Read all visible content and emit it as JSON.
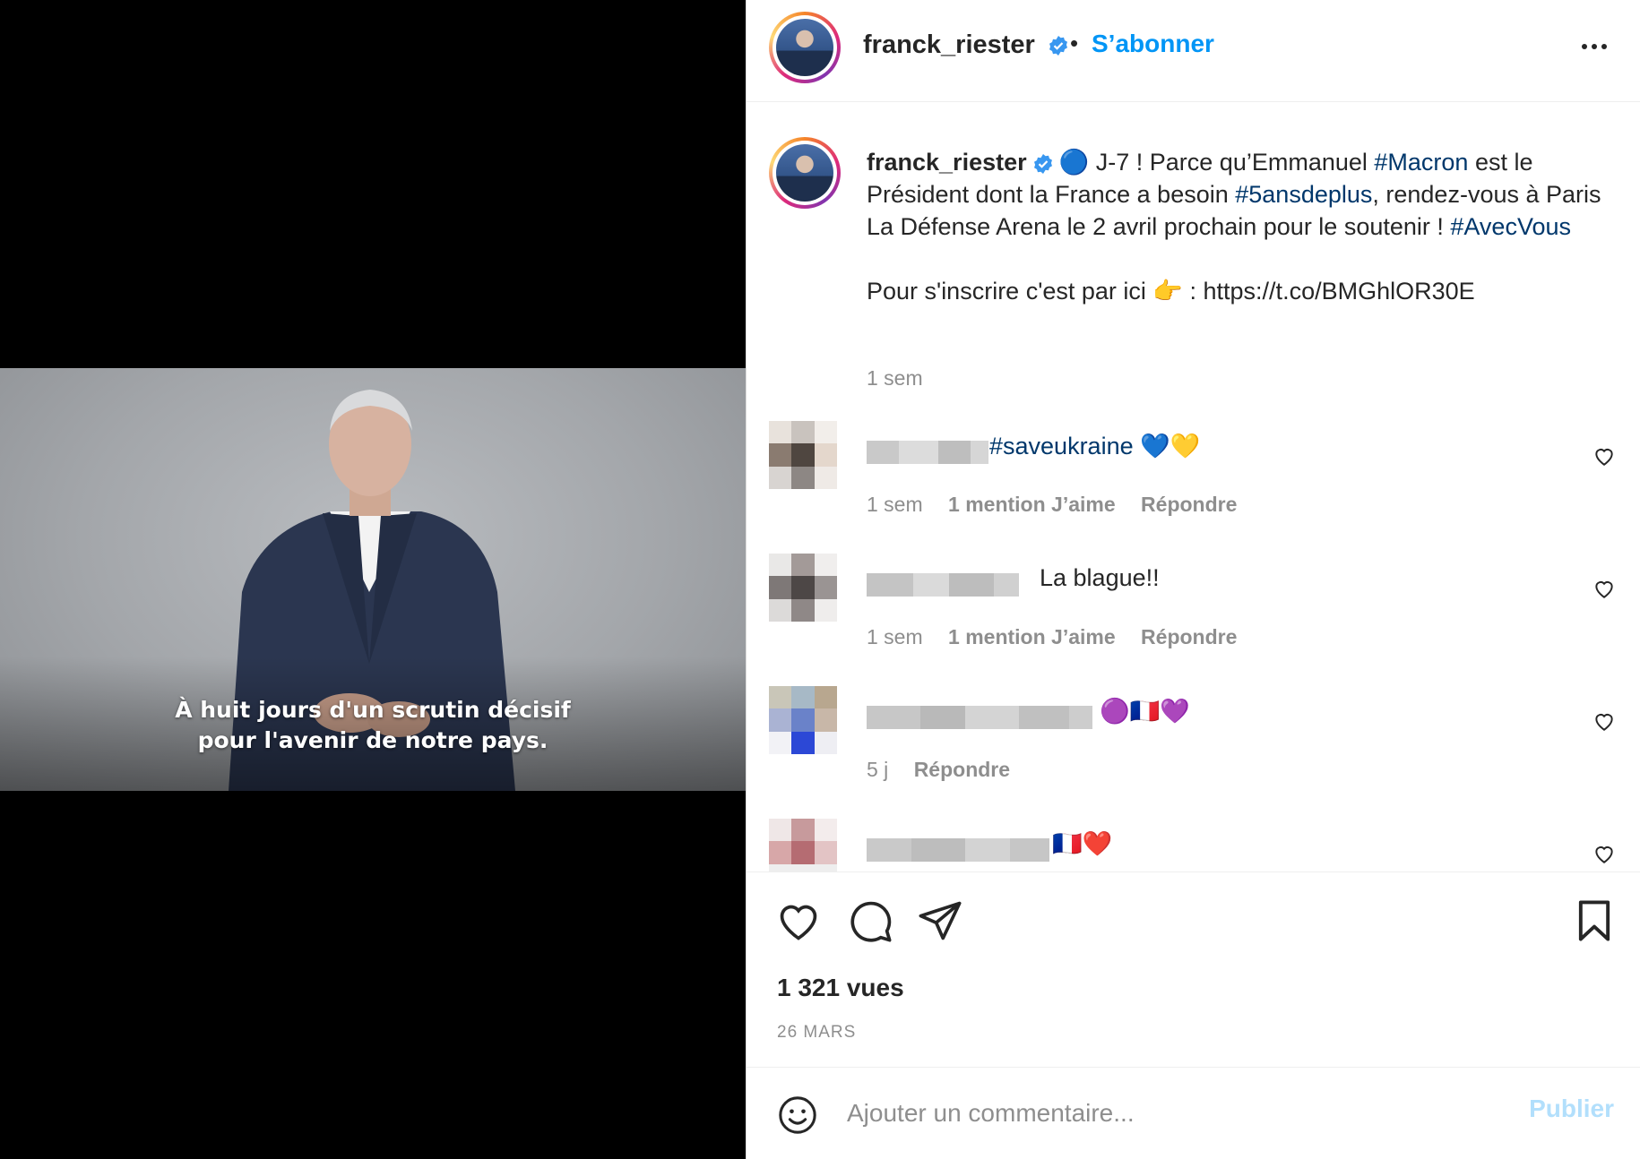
{
  "video": {
    "subtitle_line1": "À huit jours d'un scrutin décisif",
    "subtitle_line2": "pour l'avenir de notre pays."
  },
  "header": {
    "username": "franck_riester",
    "separator": "•",
    "follow_label": "S’abonner",
    "verified_icon": "verified-badge-icon",
    "more_icon": "more-options-icon"
  },
  "caption": {
    "username": "franck_riester",
    "emoji": "🔵",
    "part1": " J-7 ! Parce qu’Emmanuel ",
    "tag1": "#Macron",
    "part2": " est le Président dont la France a besoin ",
    "tag2": "#5ansdeplus",
    "part3": ", rendez-vous à Paris La Défense Arena le 2 avril prochain pour le soutenir ! ",
    "tag3": "#AvecVous",
    "line2": "Pour s'inscrire c'est par ici 👉 : https://t.co/BMGhlOR30E",
    "time": "1 sem"
  },
  "comments": [
    {
      "text_tag": "#saveukraine",
      "text_emoji": " 💙💛",
      "time": "1 sem",
      "likes": "1 mention J’aime",
      "reply": "Répondre"
    },
    {
      "text": "La blague!!",
      "time": "1 sem",
      "likes": "1 mention J’aime",
      "reply": "Répondre"
    },
    {
      "text": "🟣🇫🇷💜",
      "time": "5 j",
      "reply": "Répondre"
    },
    {
      "text": "🇫🇷❤️"
    }
  ],
  "actions": {
    "views": "1 321 vues",
    "date": "26 MARS"
  },
  "add_comment": {
    "placeholder": "Ajouter un commentaire...",
    "publish_label": "Publier"
  },
  "colors": {
    "accent": "#0095f6",
    "hashtag": "#00376b",
    "muted": "#8e8e8e",
    "publish_disabled": "#b2dffc"
  }
}
